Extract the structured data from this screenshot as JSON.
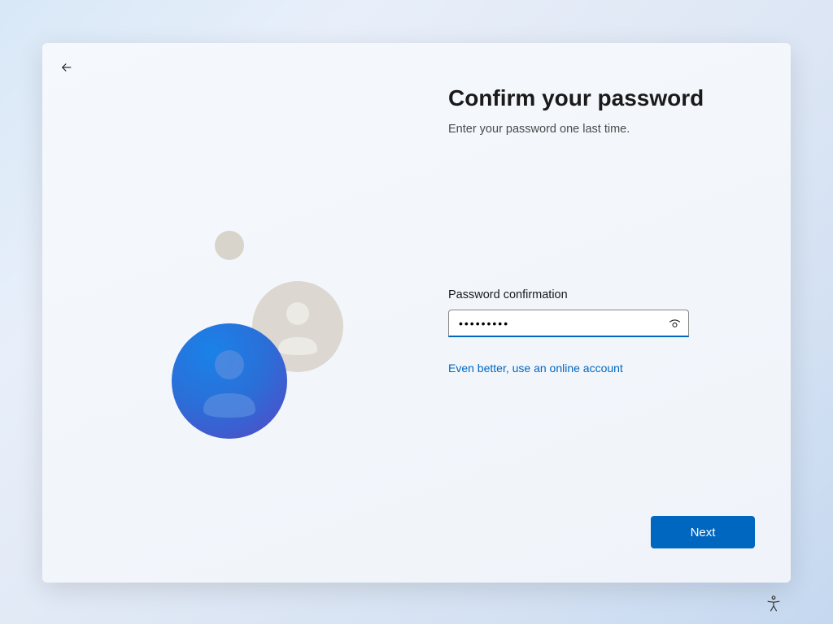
{
  "header": {
    "title": "Confirm your password",
    "subtitle": "Enter your password one last time."
  },
  "form": {
    "password_label": "Password confirmation",
    "password_value": "•••••••••",
    "online_account_link": "Even better, use an online account"
  },
  "actions": {
    "next_button": "Next"
  },
  "colors": {
    "accent": "#0067c0",
    "text_primary": "#1a1a1a"
  }
}
